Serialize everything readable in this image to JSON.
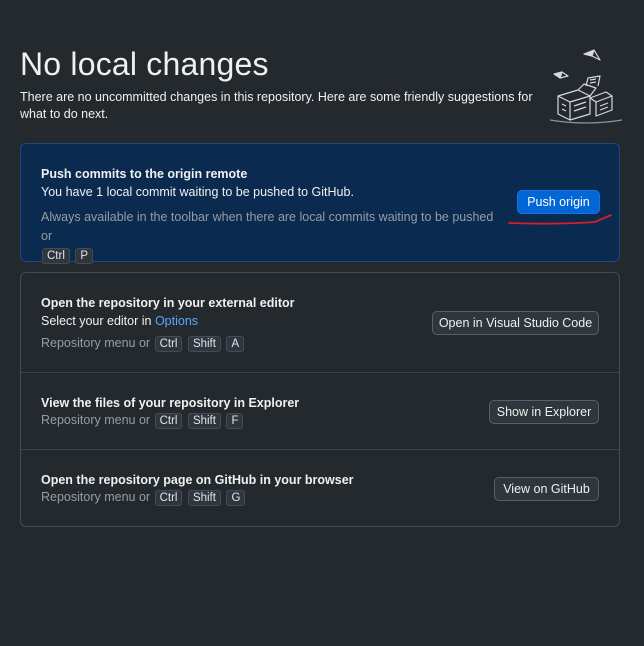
{
  "header": {
    "title": "No local changes",
    "subtitle": "There are no uncommitted changes in this repository. Here are some friendly suggestions for what to do next."
  },
  "push": {
    "title": "Push commits to the origin remote",
    "description": "You have 1 local commit waiting to be pushed to GitHub.",
    "hint": "Always available in the toolbar when there are local commits waiting to be pushed or",
    "keys": [
      "Ctrl",
      "P"
    ],
    "button": "Push origin"
  },
  "suggestions": [
    {
      "title": "Open the repository in your external editor",
      "description_prefix": "Select your editor in ",
      "description_link": "Options",
      "hint": "Repository menu or",
      "keys": [
        "Ctrl",
        "Shift",
        "A"
      ],
      "button": "Open in Visual Studio Code"
    },
    {
      "title": "View the files of your repository in Explorer",
      "hint": "Repository menu or",
      "keys": [
        "Ctrl",
        "Shift",
        "F"
      ],
      "button": "Show in Explorer"
    },
    {
      "title": "Open the repository page on GitHub in your browser",
      "hint": "Repository menu or",
      "keys": [
        "Ctrl",
        "Shift",
        "G"
      ],
      "button": "View on GitHub"
    }
  ],
  "colors": {
    "background": "#24292e",
    "primary_card": "#0b2a4f",
    "accent_button": "#0366d6",
    "link": "#58a6ff",
    "annotation": "#d2202a"
  },
  "icons": {
    "illustration": "empty-desk-illustration"
  }
}
